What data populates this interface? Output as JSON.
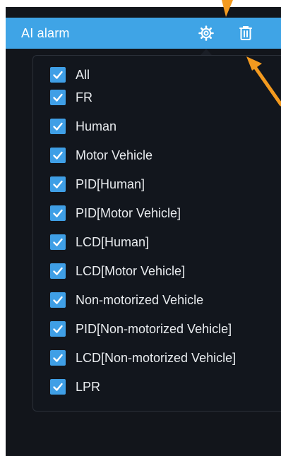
{
  "header": {
    "title": "AI alarm",
    "settings_icon": "gear-icon",
    "delete_icon": "trash-icon"
  },
  "options": [
    {
      "label": "All",
      "checked": true
    },
    {
      "label": "FR",
      "checked": true
    },
    {
      "label": "Human",
      "checked": true
    },
    {
      "label": "Motor Vehicle",
      "checked": true
    },
    {
      "label": "PID[Human]",
      "checked": true
    },
    {
      "label": "PID[Motor Vehicle]",
      "checked": true
    },
    {
      "label": "LCD[Human]",
      "checked": true
    },
    {
      "label": "LCD[Motor Vehicle]",
      "checked": true
    },
    {
      "label": "Non-motorized Vehicle",
      "checked": true
    },
    {
      "label": "PID[Non-motorized Vehicle]",
      "checked": true
    },
    {
      "label": "LCD[Non-motorized Vehicle]",
      "checked": true
    },
    {
      "label": "LPR",
      "checked": true
    }
  ],
  "colors": {
    "header": "#3fa4e6",
    "checkbox": "#3f9fe6",
    "annotation_arrow": "#f39a1f"
  }
}
